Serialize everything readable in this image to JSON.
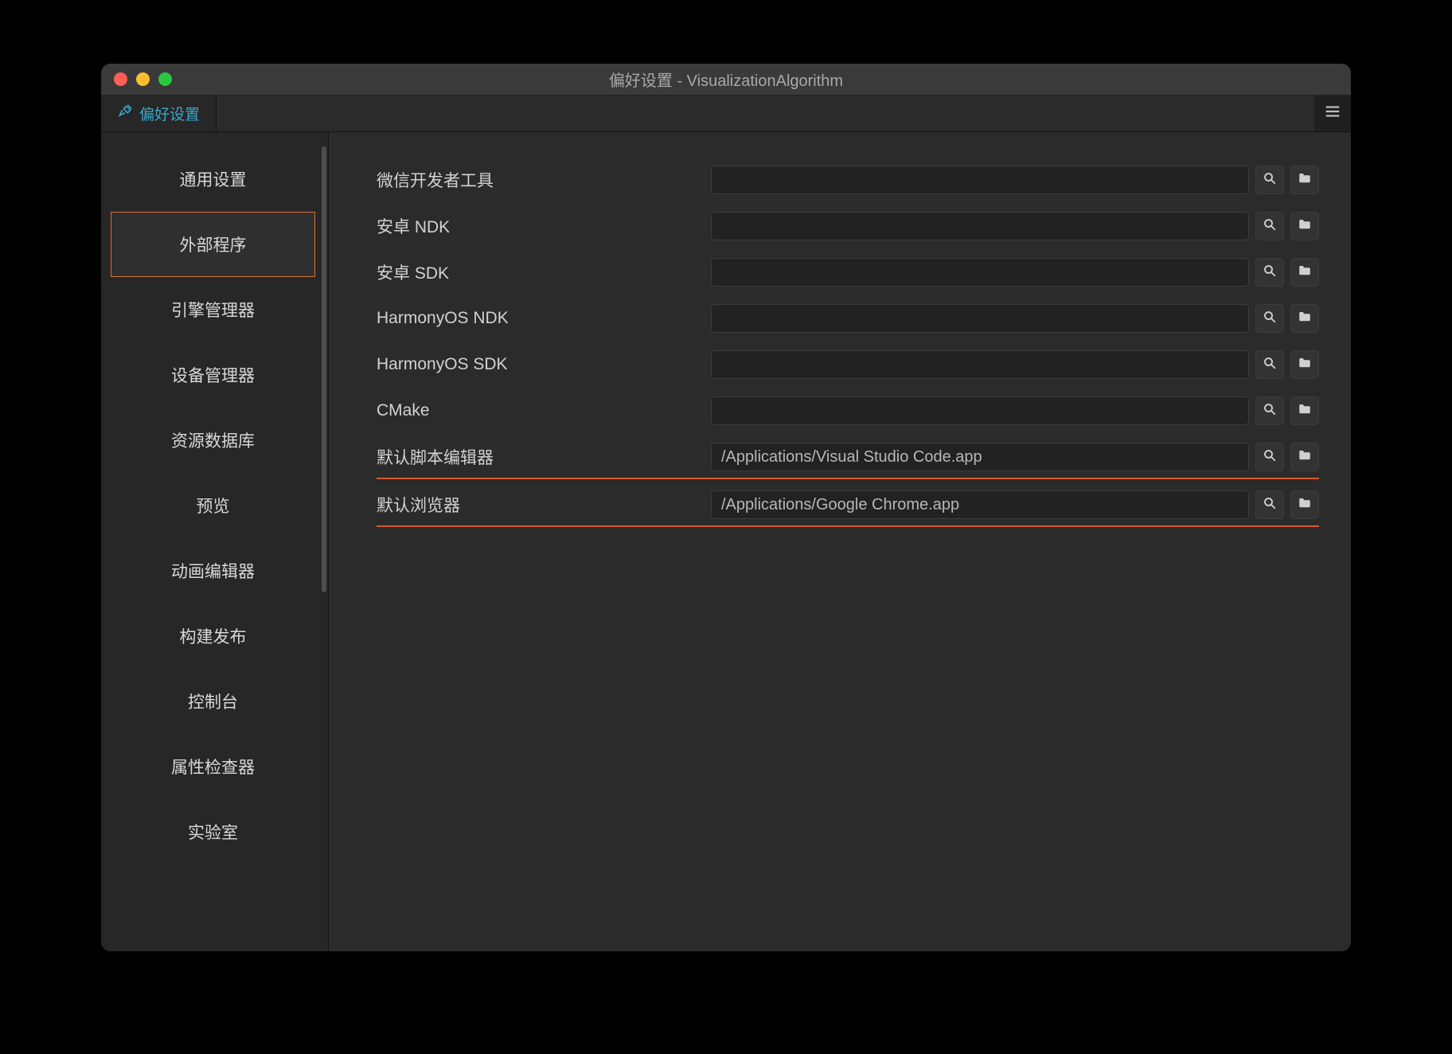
{
  "window": {
    "title": "偏好设置 - VisualizationAlgorithm"
  },
  "tab": {
    "label": "偏好设置"
  },
  "sidebar": {
    "items": [
      {
        "label": "通用设置"
      },
      {
        "label": "外部程序"
      },
      {
        "label": "引擎管理器"
      },
      {
        "label": "设备管理器"
      },
      {
        "label": "资源数据库"
      },
      {
        "label": "预览"
      },
      {
        "label": "动画编辑器"
      },
      {
        "label": "构建发布"
      },
      {
        "label": "控制台"
      },
      {
        "label": "属性检查器"
      },
      {
        "label": "实验室"
      }
    ],
    "active_index": 1
  },
  "fields": [
    {
      "label": "微信开发者工具",
      "value": "",
      "underline": false
    },
    {
      "label": "安卓 NDK",
      "value": "",
      "underline": false
    },
    {
      "label": "安卓 SDK",
      "value": "",
      "underline": false
    },
    {
      "label": "HarmonyOS NDK",
      "value": "",
      "underline": false
    },
    {
      "label": "HarmonyOS SDK",
      "value": "",
      "underline": false
    },
    {
      "label": "CMake",
      "value": "",
      "underline": false
    },
    {
      "label": "默认脚本编辑器",
      "value": "/Applications/Visual Studio Code.app",
      "underline": true
    },
    {
      "label": "默认浏览器",
      "value": "/Applications/Google Chrome.app",
      "underline": true
    }
  ]
}
